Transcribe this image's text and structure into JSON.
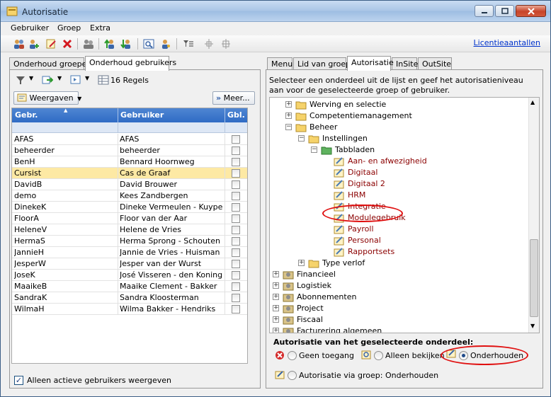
{
  "window": {
    "title": "Autorisatie"
  },
  "menu": [
    "Gebruiker",
    "Groep",
    "Extra"
  ],
  "toolbar": {
    "license_link": "Licentieaantallen"
  },
  "left": {
    "tabs": [
      "Onderhoud groepen",
      "Onderhoud gebruikers"
    ],
    "record_count": "16 Regels",
    "weergaven": "Weergaven",
    "meer": "Meer...",
    "columns": [
      "Gebr.",
      "Gebruiker",
      "Gbl."
    ],
    "rows": [
      {
        "code": "AFAS",
        "name": "AFAS"
      },
      {
        "code": "beheerder",
        "name": "beheerder"
      },
      {
        "code": "BenH",
        "name": "Bennard Hoornweg"
      },
      {
        "code": "Cursist",
        "name": "Cas de Graaf"
      },
      {
        "code": "DavidB",
        "name": "David Brouwer"
      },
      {
        "code": "demo",
        "name": "Kees Zandbergen"
      },
      {
        "code": "DinekeK",
        "name": "Dineke Vermeulen - Kuypers"
      },
      {
        "code": "FloorA",
        "name": "Floor van der Aar"
      },
      {
        "code": "HeleneV",
        "name": "Helene de Vries"
      },
      {
        "code": "HermaS",
        "name": "Herma Sprong - Schouten"
      },
      {
        "code": "JannieH",
        "name": "Jannie de Vries - Huisman"
      },
      {
        "code": "JesperW",
        "name": "Jesper van der Wurst"
      },
      {
        "code": "JoseK",
        "name": "José Visseren - den Koning"
      },
      {
        "code": "MaaikeB",
        "name": "Maaike Clement - Bakker"
      },
      {
        "code": "SandraK",
        "name": "Sandra Kloosterman"
      },
      {
        "code": "WilmaH",
        "name": "Wilma Bakker - Hendriks"
      }
    ],
    "selected_row": "Cursist",
    "active_only_label": "Alleen actieve gebruikers weergeven"
  },
  "right": {
    "tabs": [
      "Menu",
      "Lid van groep",
      "Autorisatie",
      "InSite",
      "OutSite"
    ],
    "active_tab": "Autorisatie",
    "description": "Selecteer een onderdeel uit de lijst en geef het autorisatieniveau aan voor de geselecteerde groep of gebruiker.",
    "tree": [
      {
        "label": "Werving en selectie",
        "expander": "+"
      },
      {
        "label": "Competentiemanagement",
        "expander": "+"
      },
      {
        "label": "Beheer",
        "expander": "−"
      },
      {
        "label": "Instellingen",
        "expander": "−"
      },
      {
        "label": "Tabbladen",
        "expander": "−"
      },
      {
        "label": "Aan- en afwezigheid"
      },
      {
        "label": "Digitaal"
      },
      {
        "label": "Digitaal 2"
      },
      {
        "label": "HRM"
      },
      {
        "label": "Integratie"
      },
      {
        "label": "Modulegebruik"
      },
      {
        "label": "Payroll"
      },
      {
        "label": "Personal"
      },
      {
        "label": "Rapportsets"
      },
      {
        "label": "Type verlof",
        "expander": "+"
      },
      {
        "label": "Financieel",
        "expander": "+"
      },
      {
        "label": "Logistiek",
        "expander": "+"
      },
      {
        "label": "Abonnementen",
        "expander": "+"
      },
      {
        "label": "Project",
        "expander": "+"
      },
      {
        "label": "Fiscaal",
        "expander": "+"
      },
      {
        "label": "Facturering algemeen",
        "expander": "+"
      }
    ],
    "auth_title": "Autorisatie van het geselecteerde onderdeel:",
    "options": [
      "Geen toegang",
      "Alleen bekijken",
      "Onderhouden"
    ],
    "selected_option": "Onderhouden",
    "via_group": "Autorisatie via groep: Onderhouden"
  },
  "colors": {
    "accent": "#2f6bc5",
    "selected_row": "#fde9a4",
    "highlight": "#e01010",
    "link": "#8b0000"
  }
}
